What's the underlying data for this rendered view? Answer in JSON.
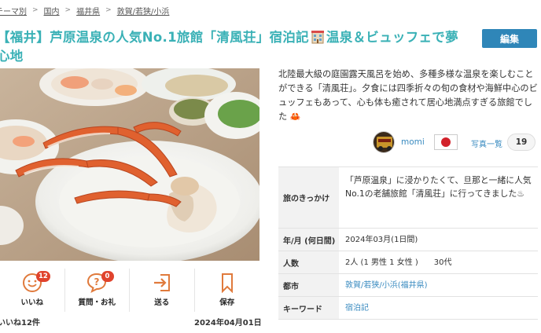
{
  "breadcrumb": [
    "テーマ別",
    "国内",
    "福井県",
    "敦賀/若狭/小浜"
  ],
  "title_part1": "【福井】芦原温泉の人気No.1旅館「清風荘」宿泊記",
  "title_part2": "温泉＆ビュッフェで夢心地",
  "edit_label": "編集",
  "description": "北陸最大級の庭園露天風呂を始め、多種多様な温泉を楽しむことができる「清風荘」。夕食には四季折々の旬の食材や海鮮中心のビュッフェもあって、心も体も癒されて居心地満点すぎる旅館でした",
  "description_icon": "crab-icon",
  "author": {
    "name": "momi"
  },
  "photos": {
    "label": "写真一覧",
    "count": "19"
  },
  "info": {
    "reason_label": "旅のきっかけ",
    "reason_value": "「芦原温泉」に浸かりたくて、旦那と一緒に人気No.1の老舗旅館「清風荘」に行ってきました♨",
    "date_label": "年/月 (何日間)",
    "date_value": "2024年03月(1日間)",
    "people_label": "人数",
    "people_value": "2人 (1 男性 1 女性 )　　30代",
    "city_label": "都市",
    "city_value": "敦賀/若狭/小浜(福井県)",
    "keyword_label": "キーワード",
    "keyword_value": "宿泊記"
  },
  "actions": {
    "like_label": "いいね",
    "like_count": "12",
    "question_label": "質問・お礼",
    "question_count": "0",
    "send_label": "送る",
    "save_label": "保存"
  },
  "likes_text": "いいね12件",
  "post_date": "2024年04月01日",
  "colors": {
    "title": "#3ab1b6",
    "edit_button": "#2f86b8",
    "link": "#3a8bc0",
    "badge": "#e0432d",
    "flag_red": "#d2212a"
  }
}
